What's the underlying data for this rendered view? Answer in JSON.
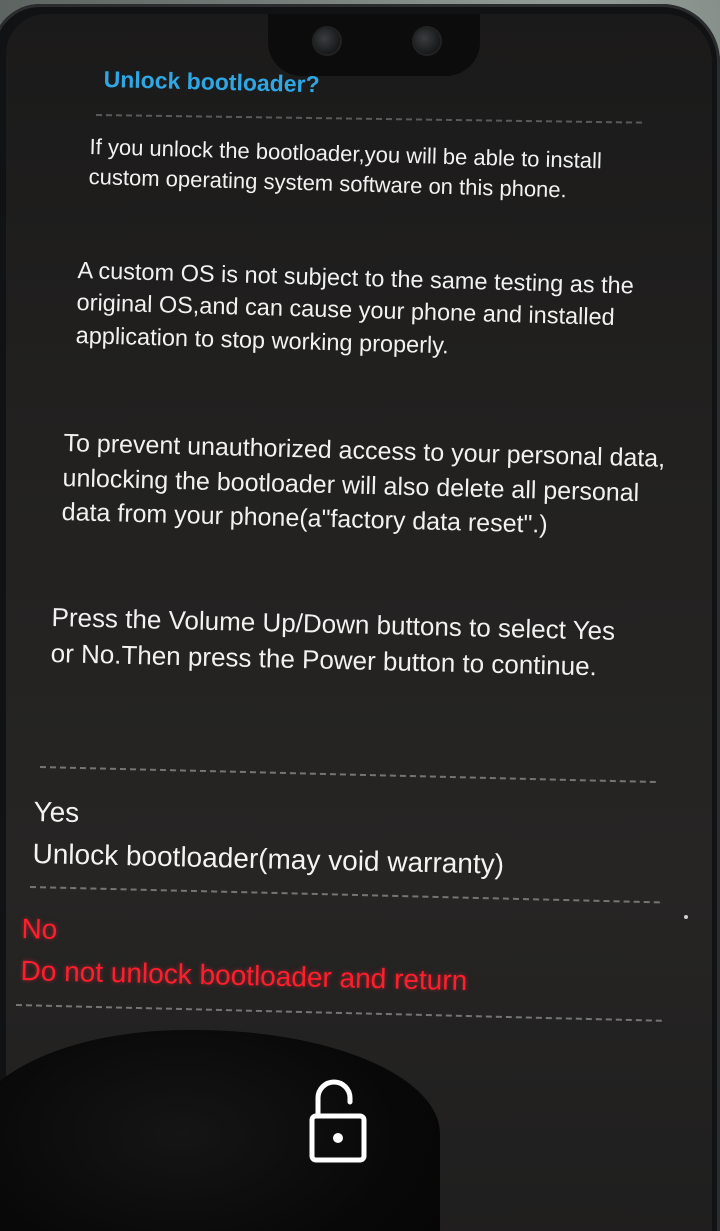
{
  "screen": {
    "title": "Unlock bootloader?",
    "paragraphs": [
      "If you unlock the bootloader,you will be able to install custom operating system software on this phone.",
      "A custom OS is not subject to the same testing as the original OS,and can cause your phone and installed application to stop working properly.",
      "To prevent unauthorized access to your personal data, unlocking the bootloader will also delete all  personal data from your phone(a\"factory data reset\".)",
      "Press the Volume Up/Down buttons to select Yes or No.Then press the Power button to continue."
    ],
    "options": [
      {
        "label": "Yes",
        "description": "Unlock bootloader(may void warranty)",
        "color": "#f3f3f3"
      },
      {
        "label": "No",
        "description": "Do not unlock bootloader and return",
        "color": "#ff1e2d",
        "selected": true
      }
    ],
    "icon": "unlocked-padlock-icon"
  },
  "colors": {
    "title": "#2fa7e4",
    "text": "#f1f1f1",
    "selected": "#ff1e2d",
    "background": "#222120"
  }
}
